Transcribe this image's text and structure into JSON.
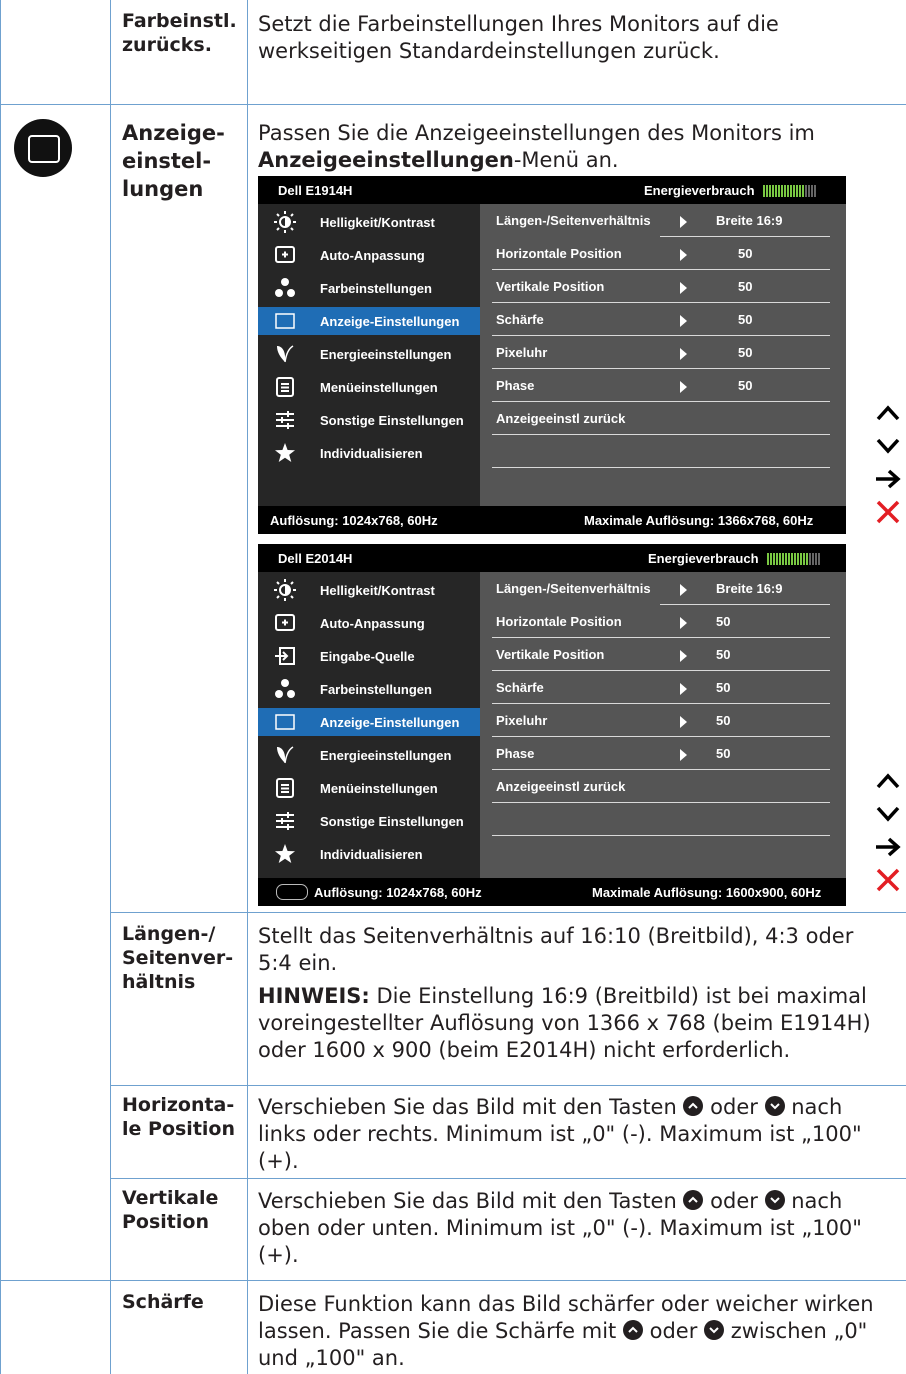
{
  "rows": {
    "reset_color": {
      "label": "Farbeinstl.\nzurücks.",
      "desc": "Setzt die Farbeinstellungen Ihres Monitors auf die werkseitigen Standardeinstellungen zurück."
    },
    "display": {
      "label": "Anzeige-\neinstel-\nlungen",
      "icon": "display-settings-icon",
      "desc_prefix": "Passen Sie die Anzeigeeinstellungen des Monitors im ",
      "desc_bold": "Anzeigeeinstellungen",
      "desc_suffix": "-Menü an."
    },
    "aspect": {
      "label": "Längen-/\nSeitenver-\nhältnis",
      "desc": "Stellt das Seitenverhältnis auf 16:10 (Breitbild), 4:3 oder 5:4 ein.",
      "note_label": "HINWEIS:",
      "note": " Die Einstellung 16:9 (Breitbild) ist bei maximal voreingestellter Auflösung von 1366 x 768 (beim E1914H) oder 1600 x 900 (beim E2014H) nicht erforderlich."
    },
    "hpos": {
      "label": "Horizonta-\nle Position",
      "desc_a": "Verschieben Sie das Bild mit den Tasten ",
      "desc_b": " oder ",
      "desc_c": " nach links oder rechts. Minimum ist „0\" (-). Maximum ist „100\" (+)."
    },
    "vpos": {
      "label": "Vertikale\nPosition",
      "desc_a": " Verschieben Sie das Bild mit den Tasten ",
      "desc_b": " oder ",
      "desc_c": " nach oben oder unten. Minimum ist „0\" (-). Maximum ist „100\" (+)."
    },
    "sharp": {
      "label": "Schärfe",
      "desc_a": "Diese Funktion kann das Bild schärfer oder weicher wirken lassen. Passen Sie die Schärfe mit ",
      "desc_b": " oder ",
      "desc_c": " zwischen „0\" und „100\" an."
    }
  },
  "osd1": {
    "model": "Dell E1914H",
    "energy_label": "Energieverbrauch",
    "menu": [
      "Helligkeit/Kontrast",
      "Auto-Anpassung",
      "Farbeinstellungen",
      "Anzeige-Einstellungen",
      "Energieeinstellungen",
      "Menüeinstellungen",
      "Sonstige Einstellungen",
      "Individualisieren"
    ],
    "menu_icons": [
      "brightness-icon",
      "auto-adjust-icon",
      "color-icon",
      "display-icon",
      "energy-icon",
      "menu-icon",
      "other-settings-icon",
      "star-icon"
    ],
    "selected_index": 3,
    "items": [
      {
        "label": "Längen-/Seitenverhältnis",
        "value": "Breite 16:9"
      },
      {
        "label": "Horizontale Position",
        "value": "50"
      },
      {
        "label": "Vertikale Position",
        "value": "50"
      },
      {
        "label": "Schärfe",
        "value": "50"
      },
      {
        "label": "Pixeluhr",
        "value": "50"
      },
      {
        "label": "Phase",
        "value": "50"
      },
      {
        "label": "Anzeigeeinstl zurück",
        "value": ""
      }
    ],
    "resolution": "Auflösung: 1024x768, 60Hz",
    "max_resolution": "Maximale Auflösung: 1366x768, 60Hz"
  },
  "osd2": {
    "model": "Dell E2014H",
    "energy_label": "Energieverbrauch",
    "menu": [
      "Helligkeit/Kontrast",
      "Auto-Anpassung",
      "Eingabe-Quelle",
      "Farbeinstellungen",
      "Anzeige-Einstellungen",
      "Energieeinstellungen",
      "Menüeinstellungen",
      "Sonstige Einstellungen",
      "Individualisieren"
    ],
    "menu_icons": [
      "brightness-icon",
      "auto-adjust-icon",
      "input-source-icon",
      "color-icon",
      "display-icon",
      "energy-icon",
      "menu-icon",
      "other-settings-icon",
      "star-icon"
    ],
    "selected_index": 4,
    "items": [
      {
        "label": "Längen-/Seitenverhältnis",
        "value": "Breite 16:9"
      },
      {
        "label": "Horizontale Position",
        "value": "50"
      },
      {
        "label": "Vertikale Position",
        "value": "50"
      },
      {
        "label": "Schärfe",
        "value": "50"
      },
      {
        "label": "Pixeluhr",
        "value": "50"
      },
      {
        "label": "Phase",
        "value": "50"
      }
    ],
    "reset_label": "Anzeigeeinstl zurück",
    "resolution": "Auflösung: 1024x768, 60Hz",
    "max_resolution": "Maximale Auflösung: 1600x900, 60Hz",
    "connector_icon": "vga-connector-icon"
  },
  "nav_icons": [
    "up-arrow-icon",
    "down-arrow-icon",
    "enter-arrow-icon",
    "exit-x-icon"
  ],
  "colors": {
    "grid_line": "#6fa1cf",
    "osd_highlight": "#1f6db5",
    "exit": "#e31e24",
    "meter": "#7ac943"
  }
}
